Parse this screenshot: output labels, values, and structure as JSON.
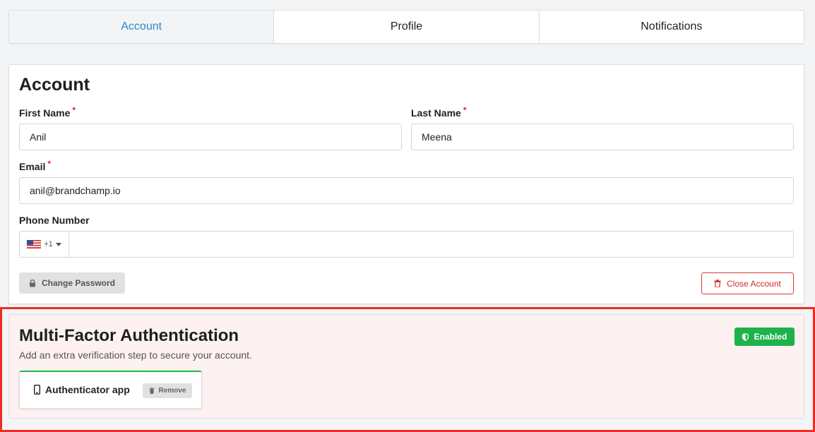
{
  "tabs": [
    {
      "label": "Account",
      "active": true
    },
    {
      "label": "Profile",
      "active": false
    },
    {
      "label": "Notifications",
      "active": false
    }
  ],
  "account": {
    "title": "Account",
    "first_name": {
      "label": "First Name",
      "value": "Anil",
      "required": "*"
    },
    "last_name": {
      "label": "Last Name",
      "value": "Meena",
      "required": "*"
    },
    "email": {
      "label": "Email",
      "value": "anil@brandchamp.io",
      "required": "*"
    },
    "phone": {
      "label": "Phone Number",
      "country_code": "+1",
      "value": ""
    },
    "change_password_label": "Change Password",
    "close_account_label": "Close Account"
  },
  "mfa": {
    "title": "Multi-Factor Authentication",
    "subtitle": "Add an extra verification step to secure your account.",
    "status_label": "Enabled",
    "method_label": "Authenticator app",
    "remove_label": "Remove"
  },
  "colors": {
    "accent": "#2b87c9",
    "danger": "#d02b2b",
    "success": "#1db24a",
    "highlight": "#ee2d24"
  },
  "icons": {
    "change_password": "lock-icon",
    "close_account": "trash-icon",
    "status": "shield-icon",
    "method": "mobile-phone-icon",
    "remove": "trash-icon",
    "country": "us-flag-icon"
  }
}
